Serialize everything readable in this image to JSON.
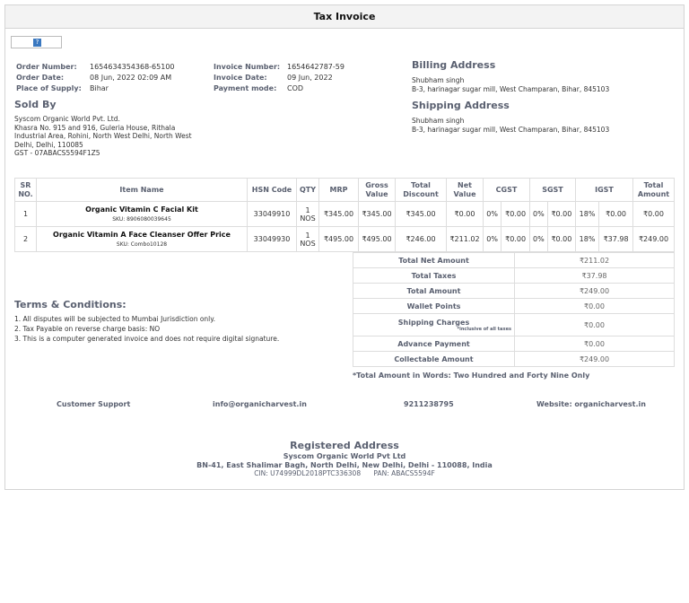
{
  "title": "Tax Invoice",
  "logo_alt": "?",
  "order": {
    "number_label": "Order Number:",
    "number": "1654634354368-65100",
    "date_label": "Order Date:",
    "date": "08 Jun, 2022 02:09 AM",
    "supply_label": "Place of Supply:",
    "supply": "Bihar"
  },
  "invoice": {
    "number_label": "Invoice Number:",
    "number": "1654642787-59",
    "date_label": "Invoice Date:",
    "date": "09 Jun, 2022",
    "payment_label": "Payment mode:",
    "payment": "COD"
  },
  "sold_by": {
    "heading": "Sold By",
    "lines": [
      "Syscom Organic World Pvt. Ltd.",
      "Khasra No. 915 and 916, Guleria House, Rithala",
      "Industrial Area, Rohini, North West Delhi, North West",
      "Delhi, Delhi, 110085",
      "GST - 07ABACS5594F1Z5"
    ]
  },
  "billing": {
    "heading": "Billing Address",
    "name": "Shubham singh",
    "address": "B-3, harinagar sugar mill, West Champaran, Bihar, 845103"
  },
  "shipping": {
    "heading": "Shipping Address",
    "name": "Shubham singh",
    "address": "B-3, harinagar sugar mill, West Champaran, Bihar, 845103"
  },
  "table": {
    "headers": [
      "SR NO.",
      "Item Name",
      "HSN Code",
      "QTY",
      "MRP",
      "Gross Value",
      "Total Discount",
      "Net Value",
      "CGST",
      "SGST",
      "IGST",
      "Total Amount"
    ],
    "rows": [
      {
        "sr": "1",
        "name": "Organic Vitamin C Facial Kit",
        "sku": "SKU: 8906080039645",
        "hsn": "33049910",
        "qty": "1 NOS",
        "mrp": "₹345.00",
        "gross": "₹345.00",
        "discount": "₹345.00",
        "net": "₹0.00",
        "cgst_rate": "0%",
        "cgst": "₹0.00",
        "sgst_rate": "0%",
        "sgst": "₹0.00",
        "igst_rate": "18%",
        "igst": "₹0.00",
        "total": "₹0.00"
      },
      {
        "sr": "2",
        "name": "Organic Vitamin A Face Cleanser Offer Price",
        "sku": "SKU: Combo10128",
        "hsn": "33049930",
        "qty": "1 NOS",
        "mrp": "₹495.00",
        "gross": "₹495.00",
        "discount": "₹246.00",
        "net": "₹211.02",
        "cgst_rate": "0%",
        "cgst": "₹0.00",
        "sgst_rate": "0%",
        "sgst": "₹0.00",
        "igst_rate": "18%",
        "igst": "₹37.98",
        "total": "₹249.00"
      }
    ]
  },
  "summary": [
    {
      "label": "Total Net Amount",
      "value": "₹211.02"
    },
    {
      "label": "Total Taxes",
      "value": "₹37.98"
    },
    {
      "label": "Total Amount",
      "value": "₹249.00"
    },
    {
      "label": "Wallet Points",
      "value": "₹0.00"
    },
    {
      "label": "Shipping Charges",
      "note": "*inclusive of all taxes",
      "value": "₹0.00"
    },
    {
      "label": "Advance Payment",
      "value": "₹0.00"
    },
    {
      "label": "Collectable Amount",
      "value": "₹249.00"
    }
  ],
  "amount_words": "*Total Amount in Words: Two Hundred and Forty Nine Only",
  "terms": {
    "heading": "Terms & Conditions:",
    "items": [
      "1.  All disputes will be subjected to Mumbai Jurisdiction only.",
      "2.  Tax Payable on reverse charge basis: NO",
      "3.  This is a computer generated invoice and does not require digital signature."
    ]
  },
  "footer": {
    "support": "Customer Support",
    "email": "info@organicharvest.in",
    "phone": "9211238795",
    "website": "Website: organicharvest.in"
  },
  "registered": {
    "heading": "Registered Address",
    "company": "Syscom Organic World Pvt Ltd",
    "address": "BN-41, East Shalimar Bagh, North Delhi, New Delhi, Delhi - 110088, India",
    "cin": "CIN: U74999DL2018PTC336308",
    "pan": "PAN: ABACS5594F"
  }
}
